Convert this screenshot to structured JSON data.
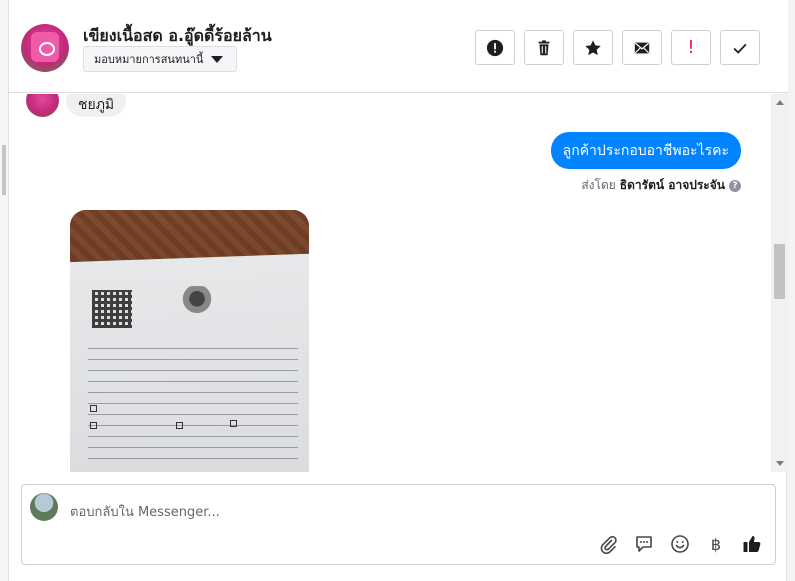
{
  "header": {
    "page_name": "เขียงเนื้อสด อ.อู๊ดดี้ร้อยล้าน",
    "assign_label": "มอบหมายการสนทนานี้",
    "actions": [
      {
        "name": "spam-button",
        "icon": "alert-circle-icon"
      },
      {
        "name": "delete-button",
        "icon": "trash-icon"
      },
      {
        "name": "star-button",
        "icon": "star-icon"
      },
      {
        "name": "mark-unread-button",
        "icon": "envelope-icon"
      },
      {
        "name": "follow-up-button",
        "icon": "exclamation-icon",
        "glyph": "!"
      },
      {
        "name": "mark-done-button",
        "icon": "check-icon"
      }
    ]
  },
  "conversation": {
    "customer_message": "ชยภูมิ",
    "outgoing_message": "ลูกค้าประกอบอาชีพอะไรคะ",
    "sent_by_prefix": "ส่งโดย",
    "sent_by_name": "ธิดารัตน์ อาจประจัน",
    "info_glyph": "?"
  },
  "composer": {
    "placeholder": "ตอบกลับใน Messenger...",
    "currency_glyph": "฿"
  },
  "colors": {
    "accent": "#0084ff",
    "danger": "#e41e3f"
  }
}
